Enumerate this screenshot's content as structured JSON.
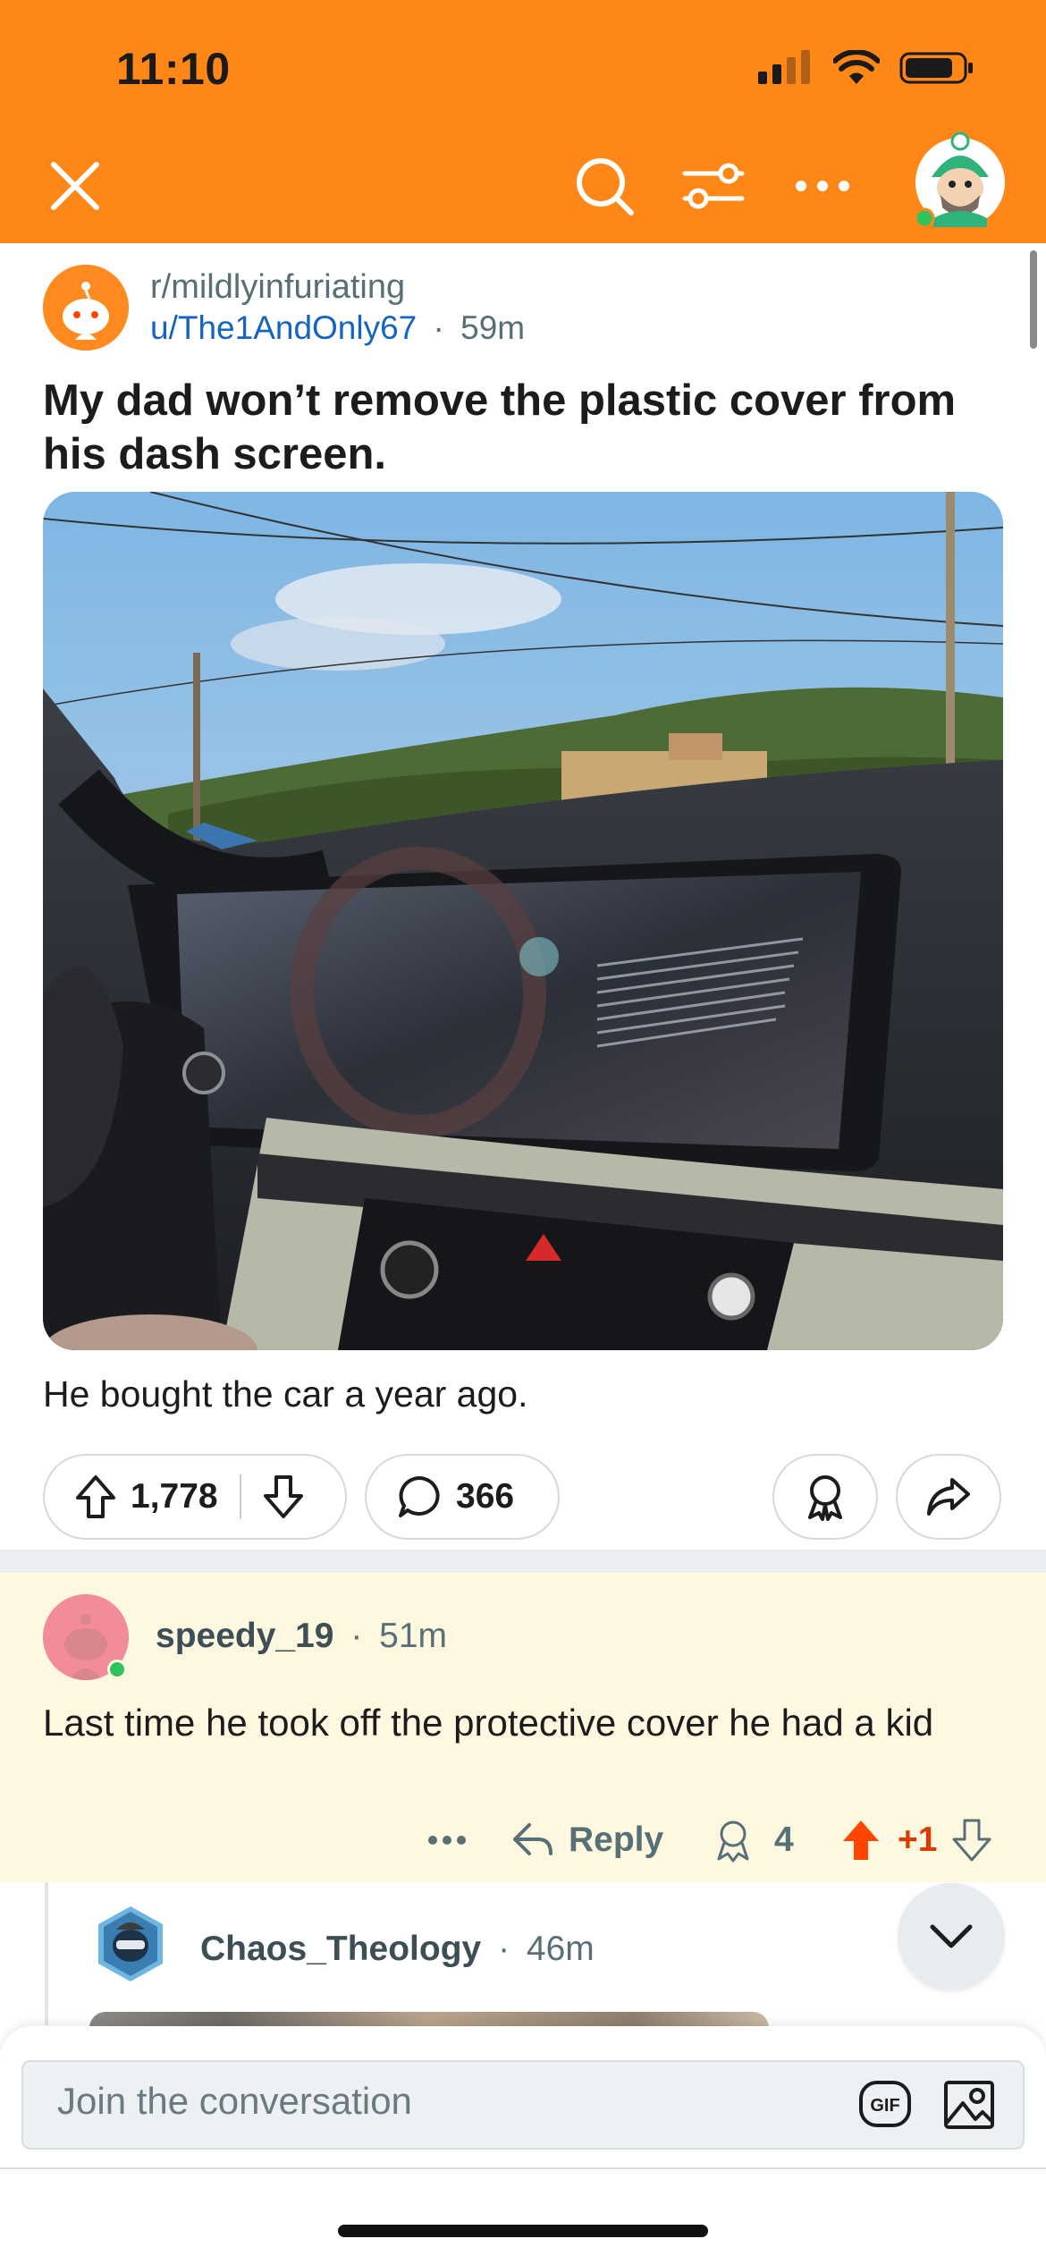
{
  "status_bar": {
    "time": "11:10"
  },
  "colors": {
    "header": "#ff8717",
    "upvote": "#ff4500",
    "username": "#576f76",
    "link": "#1565c0"
  },
  "header": {
    "icons": [
      "close-icon",
      "search-icon",
      "sort-filter-icon",
      "more-icon",
      "user-avatar"
    ]
  },
  "post": {
    "subreddit": "r/mildlyinfuriating",
    "author": "u/The1AndOnly67",
    "separator": "·",
    "age": "59m",
    "title": "My dad won’t remove the plastic cover from his dash screen.",
    "image_alt": "Car dashboard infotainment screen with plastic cover",
    "body": "He bought the car a year ago.",
    "score": "1,778",
    "comments": "366"
  },
  "comment": {
    "username": "speedy_19",
    "separator": "·",
    "age": "51m",
    "text": "Last time he took off the protective cover he had a kid",
    "reply_label": "Reply",
    "award_count": "4",
    "vote_delta": "+1"
  },
  "reply": {
    "username": "Chaos_Theology",
    "separator": "·",
    "age": "46m"
  },
  "composer": {
    "placeholder": "Join the conversation",
    "gif_label": "GIF"
  }
}
